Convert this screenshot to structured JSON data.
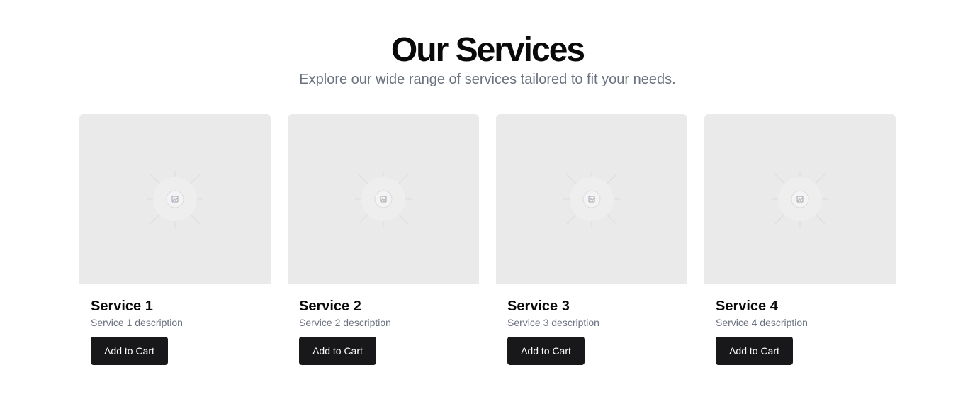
{
  "header": {
    "title": "Our Services",
    "subtitle": "Explore our wide range of services tailored to fit your needs."
  },
  "cards": [
    {
      "title": "Service 1",
      "description": "Service 1 description",
      "button_label": "Add to Cart",
      "image_icon": "image-placeholder-icon"
    },
    {
      "title": "Service 2",
      "description": "Service 2 description",
      "button_label": "Add to Cart",
      "image_icon": "image-placeholder-icon"
    },
    {
      "title": "Service 3",
      "description": "Service 3 description",
      "button_label": "Add to Cart",
      "image_icon": "image-placeholder-icon"
    },
    {
      "title": "Service 4",
      "description": "Service 4 description",
      "button_label": "Add to Cart",
      "image_icon": "image-placeholder-icon"
    }
  ],
  "colors": {
    "button_bg": "#18181b",
    "placeholder_bg": "#eaeaea",
    "muted_text": "#6b7280"
  }
}
